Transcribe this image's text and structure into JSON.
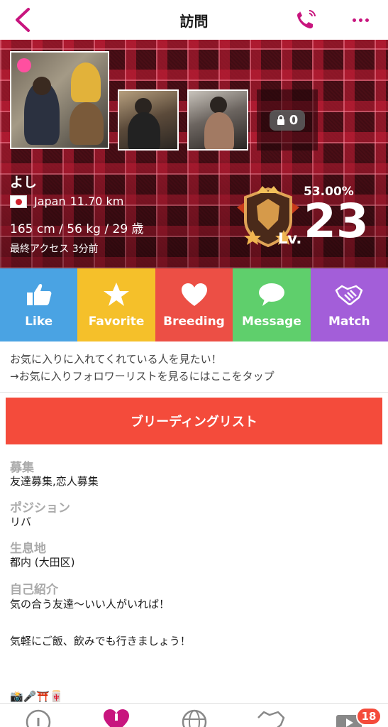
{
  "header": {
    "title": "訪問"
  },
  "profile": {
    "name": "よし",
    "country": "Japan",
    "distance": "11.70 km",
    "stats": "165 cm / 56 kg / 29 歳",
    "last_access": "最終アクセス 3分前",
    "locked_photo_count": "0",
    "level_percent": "53.00%",
    "level_prefix": "Lv.",
    "level": "23"
  },
  "actions": [
    {
      "label": "Like",
      "color": "#4aa3e3",
      "icon": "thumbs-up-icon"
    },
    {
      "label": "Favorite",
      "color": "#f5c02a",
      "icon": "star-icon"
    },
    {
      "label": "Breeding",
      "color": "#ec4f45",
      "icon": "heart-icon"
    },
    {
      "label": "Message",
      "color": "#5fcf6c",
      "icon": "speech-bubble-icon"
    },
    {
      "label": "Match",
      "color": "#a35ed9",
      "icon": "handshake-icon"
    }
  ],
  "notice": {
    "line1": "お気に入りに入れてくれている人を見たい！",
    "line2": "→お気に入りフォロワーリストを見るにはここをタップ"
  },
  "breeding_list_button": "ブリーディングリスト",
  "fields": {
    "recruit_label": "募集",
    "recruit_value": "友達募集,恋人募集",
    "position_label": "ポジション",
    "position_value": "リバ",
    "habitat_label": "生息地",
    "habitat_value": "都内 (大田区)",
    "intro_label": "自己紹介",
    "intro_value": "気の合う友達〜いい人がいれば！\n\n気軽にご飯、飲みでも行きましょう！\n\n\n📸🎤⛩️🀄\nエニタイムユーザ"
  },
  "tabbar": {
    "badge": "18"
  },
  "colors": {
    "accent": "#c8157e",
    "breeding_list": "#f44b3b"
  }
}
